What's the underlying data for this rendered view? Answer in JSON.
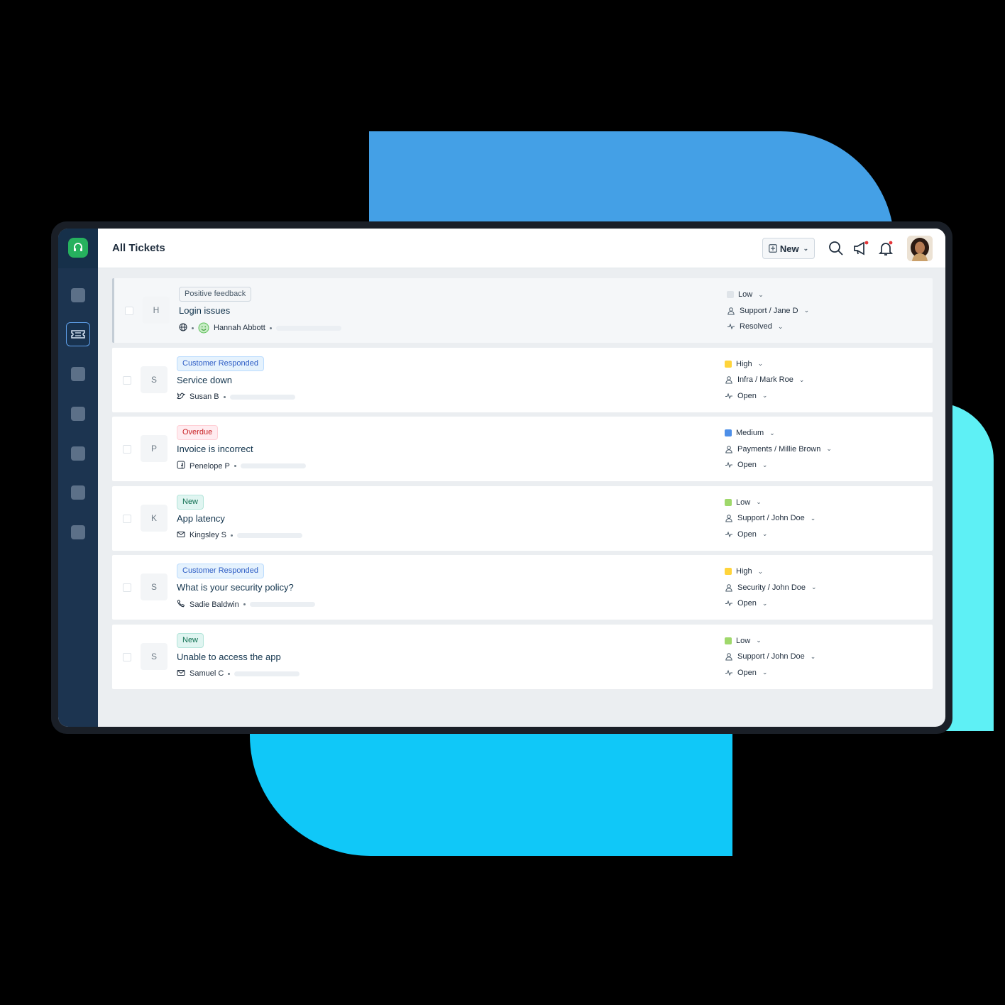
{
  "header": {
    "title": "All Tickets",
    "new_label": "New",
    "icons": [
      "search-icon",
      "megaphone-icon",
      "bell-icon"
    ]
  },
  "sidebar": {
    "logo": "headset-icon",
    "active": "ticket-icon"
  },
  "tickets": [
    {
      "initial": "H",
      "tag": "Positive feedback",
      "tag_style": "gray",
      "subject": "Login issues",
      "source_icon": "globe-icon",
      "requester": "Hannah Abbott",
      "priority": "Low",
      "priority_color": "#dfe4e9",
      "group": "Support / Jane D",
      "status": "Resolved"
    },
    {
      "initial": "S",
      "tag": "Customer Responded",
      "tag_style": "blue",
      "subject": "Service down",
      "source_icon": "twitter-icon",
      "requester": "Susan B",
      "priority": "High",
      "priority_color": "#ffd43b",
      "group": "Infra / Mark Roe",
      "status": "Open"
    },
    {
      "initial": "P",
      "tag": "Overdue",
      "tag_style": "red",
      "subject": "Invoice is incorrect",
      "source_icon": "facebook-icon",
      "requester": "Penelope P",
      "priority": "Medium",
      "priority_color": "#4d8fe8",
      "group": "Payments / Millie Brown",
      "status": "Open"
    },
    {
      "initial": "K",
      "tag": "New",
      "tag_style": "green",
      "subject": "App latency",
      "source_icon": "email-icon",
      "requester": "Kingsley S",
      "priority": "Low",
      "priority_color": "#9fd86b",
      "group": "Support / John Doe",
      "status": "Open"
    },
    {
      "initial": "S",
      "tag": "Customer Responded",
      "tag_style": "blue",
      "subject": "What is your security policy?",
      "source_icon": "phone-icon",
      "requester": "Sadie Baldwin",
      "priority": "High",
      "priority_color": "#ffd43b",
      "group": "Security / John Doe",
      "status": "Open"
    },
    {
      "initial": "S",
      "tag": "New",
      "tag_style": "green",
      "subject": "Unable to access the app",
      "source_icon": "email-icon",
      "requester": "Samuel C",
      "priority": "Low",
      "priority_color": "#9fd86b",
      "group": "Support / John Doe",
      "status": "Open"
    }
  ]
}
